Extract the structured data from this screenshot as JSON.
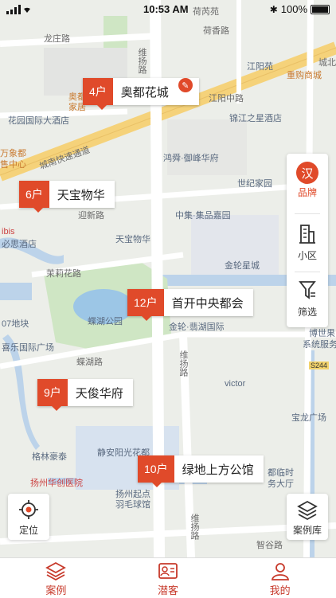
{
  "status_bar": {
    "time": "10:53 AM",
    "battery": "100%"
  },
  "map_labels": [
    {
      "text": "荷芮苑"
    },
    {
      "text": "荷香路"
    },
    {
      "text": "龙庄路"
    },
    {
      "text": "维扬路"
    },
    {
      "text": "江阳苑"
    },
    {
      "text": "城北"
    },
    {
      "text": "奥都"
    },
    {
      "text": "家居"
    },
    {
      "text": "花园国际大酒店"
    },
    {
      "text": "江阳中路"
    },
    {
      "text": "锦江之星酒店"
    },
    {
      "text": "重购商城"
    },
    {
      "text": "万象都"
    },
    {
      "text": "售中心"
    },
    {
      "text": "城南快速通道"
    },
    {
      "text": "鸿舜·御峰华府"
    },
    {
      "text": "世纪家园"
    },
    {
      "text": "迎新路"
    },
    {
      "text": "中集·集品嘉园"
    },
    {
      "text": "天宝物华"
    },
    {
      "text": "金轮星城"
    },
    {
      "text": "ibis"
    },
    {
      "text": "必思酒店"
    },
    {
      "text": "茉莉花路"
    },
    {
      "text": "蝶湖公园"
    },
    {
      "text": "金轮·翡湖国际"
    },
    {
      "text": "07地块"
    },
    {
      "text": "喜乐国际广场"
    },
    {
      "text": "蝶湖路"
    },
    {
      "text": "维扬路"
    },
    {
      "text": "博世果"
    },
    {
      "text": "系统服务"
    },
    {
      "text": "S244"
    },
    {
      "text": "victor"
    },
    {
      "text": "宝龙广场"
    },
    {
      "text": "格林豪泰"
    },
    {
      "text": "静安阳光花都"
    },
    {
      "text": "扬州华创医院"
    },
    {
      "text": "扬州起点"
    },
    {
      "text": "羽毛球馆"
    },
    {
      "text": "都临时"
    },
    {
      "text": "务大厅"
    },
    {
      "text": "维扬路"
    },
    {
      "text": "智谷路"
    }
  ],
  "markers": [
    {
      "count": "4户",
      "name": "奥都花城"
    },
    {
      "count": "6户",
      "name": "天宝物华"
    },
    {
      "count": "12户",
      "name": "首开中央都会"
    },
    {
      "count": "9户",
      "name": "天俊华府"
    },
    {
      "count": "10户",
      "name": "绿地上方公馆"
    }
  ],
  "filter_panel": {
    "brand_icon": "汉",
    "brand": "品牌",
    "district": "小区",
    "filter": "筛选"
  },
  "locate_label": "定位",
  "case_library_label": "案例库",
  "tabs": [
    {
      "label": "案例",
      "icon": "layers-icon"
    },
    {
      "label": "潜客",
      "icon": "contact-card-icon"
    },
    {
      "label": "我的",
      "icon": "person-icon"
    }
  ],
  "colors": {
    "accent": "#e04a2a",
    "water": "#bcd3ea",
    "park": "#cfe6c4",
    "road_major": "#f5d27a"
  }
}
